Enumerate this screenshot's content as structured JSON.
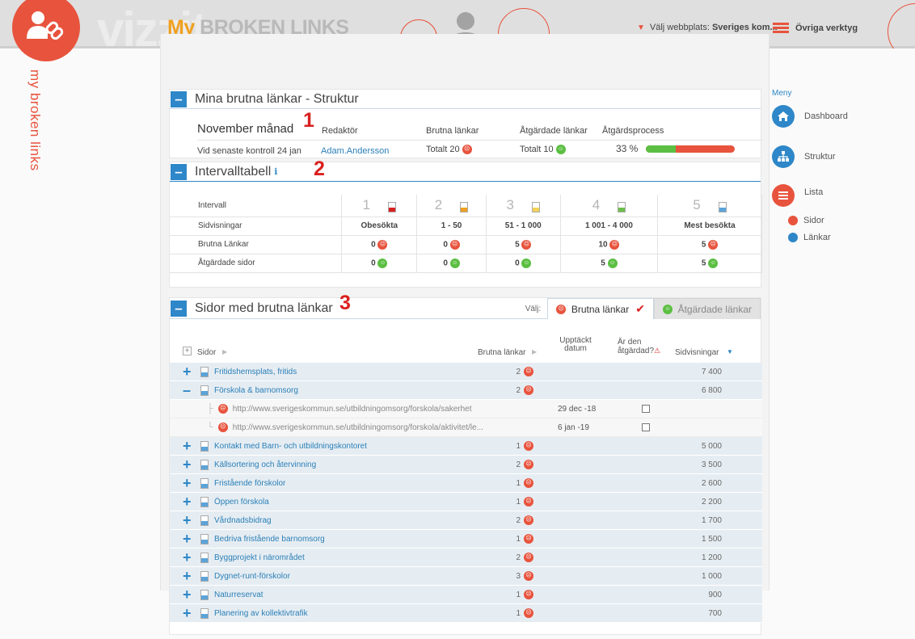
{
  "header": {
    "bg_word": "vizzit",
    "app_title_my": "My",
    "app_title_rest": " BROKEN LINKS",
    "site_label": "Välj webbplats:",
    "site_value": "Sveriges kom...",
    "tools_label": "Övriga verktyg",
    "side_label": "my broken links",
    "brand_color": "#e8533d",
    "accent_color": "#2d87c8"
  },
  "panel1": {
    "title": "Mina brutna länkar - Struktur",
    "marker": "1",
    "month_label": "November månad",
    "col_redaktor": "Redaktör",
    "col_brutna": "Brutna länkar",
    "col_atgardade": "Åtgärdade länkar",
    "col_process": "Åtgärdsprocess",
    "last_check": "Vid senaste kontroll 24 jan",
    "editor": "Adam.Andersson",
    "brutna_total": "Totalt 20",
    "atgardade_total": "Totalt 10",
    "process_pct": "33 %",
    "process_fraction": 0.33
  },
  "panel2": {
    "title": "Intervalltabell",
    "marker": "2",
    "row_labels": [
      "Intervall",
      "Sidvisningar",
      "Brutna Länkar",
      "Åtgärdade sidor"
    ],
    "intervals": [
      {
        "num": "1",
        "views": "Obesökta",
        "broken": "0",
        "fixed": "0",
        "color": "#d92020"
      },
      {
        "num": "2",
        "views": "1 - 50",
        "broken": "0",
        "fixed": "0",
        "color": "#f0a020"
      },
      {
        "num": "3",
        "views": "51 - 1 000",
        "broken": "5",
        "fixed": "0",
        "color": "#f3d35a"
      },
      {
        "num": "4",
        "views": "1 001 - 4 000",
        "broken": "10",
        "fixed": "5",
        "color": "#6cc04a"
      },
      {
        "num": "5",
        "views": "Mest besökta",
        "broken": "5",
        "fixed": "5",
        "color": "#5ba3d9"
      }
    ]
  },
  "panel3": {
    "title": "Sidor med brutna länkar",
    "marker": "3",
    "select_label": "Välj:",
    "tab_broken": "Brutna länkar",
    "tab_fixed": "Åtgärdade länkar",
    "col_sidor": "Sidor",
    "col_brutna": "Brutna länkar",
    "col_upptackt_1": "Upptäckt",
    "col_upptackt_2": "datum",
    "col_atgardad_1": "Är den",
    "col_atgardad_2": "åtgärdad?",
    "col_sidvisningar": "Sidvisningar",
    "rows": [
      {
        "title": "Fritidshemsplats, fritids",
        "count": "2",
        "views": "7 400",
        "expanded": false
      },
      {
        "title": "Förskola & barnomsorg",
        "count": "2",
        "views": "6 800",
        "expanded": true
      }
    ],
    "sub_rows": [
      {
        "url": "http://www.sverigeskommun.se/utbildningomsorg/forskola/sakerhet",
        "date": "29 dec -18"
      },
      {
        "url": "http://www.sverigeskommun.se/utbildningomsorg/forskola/aktivitet/le...",
        "date": "6 jan -19"
      }
    ],
    "rows_after": [
      {
        "title": "Kontakt med Barn- och utbildningskontoret",
        "count": "1",
        "views": "5 000"
      },
      {
        "title": "Källsortering och återvinning",
        "count": "2",
        "views": "3 500"
      },
      {
        "title": "Fristående förskolor",
        "count": "1",
        "views": "2 600"
      },
      {
        "title": "Öppen förskola",
        "count": "1",
        "views": "2 200"
      },
      {
        "title": "Vårdnadsbidrag",
        "count": "2",
        "views": "1 700"
      },
      {
        "title": "Bedriva fristående barnomsorg",
        "count": "1",
        "views": "1 500"
      },
      {
        "title": "Byggprojekt i närområdet",
        "count": "2",
        "views": "1 200"
      },
      {
        "title": "Dygnet-runt-förskolor",
        "count": "3",
        "views": "1 000"
      },
      {
        "title": "Naturreservat",
        "count": "1",
        "views": "900"
      },
      {
        "title": "Planering av kollektivtrafik",
        "count": "1",
        "views": "700"
      }
    ]
  },
  "menu": {
    "title": "Meny",
    "dashboard": "Dashboard",
    "struktur": "Struktur",
    "lista": "Lista",
    "sidor": "Sidor",
    "lankar": "Länkar"
  }
}
